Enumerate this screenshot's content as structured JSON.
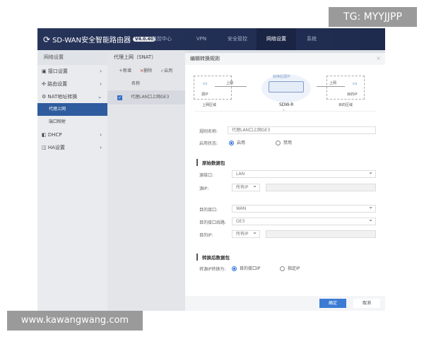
{
  "watermarks": {
    "tg": "TG: MYYJJPP",
    "site": "www.kawangwang.com"
  },
  "header": {
    "title": "SD-WAN安全智能路由器",
    "version": "V4.0.40",
    "nav": [
      "监控中心",
      "VPN",
      "安全管控",
      "网络设置",
      "系统"
    ],
    "active": "网络设置"
  },
  "sidebar": {
    "title": "网络设置",
    "items": [
      {
        "label": "接口设置",
        "icon": "interface-icon"
      },
      {
        "label": "路由设置",
        "icon": "route-icon"
      },
      {
        "label": "NAT地址转换",
        "icon": "nat-icon",
        "expanded": true
      },
      {
        "label": "代理上网",
        "sub": true,
        "selected": true
      },
      {
        "label": "端口映射",
        "sub": true
      },
      {
        "label": "DHCP",
        "icon": "dhcp-icon"
      },
      {
        "label": "HA设置",
        "icon": "ha-icon"
      }
    ]
  },
  "list": {
    "title": "代理上网（SNAT）",
    "add": "新增",
    "delete": "删除",
    "enable": "启用",
    "col_name": "名称",
    "rows": [
      {
        "name": "代理LAN口上网GE3",
        "checked": true
      }
    ]
  },
  "modal": {
    "title": "编辑转换规则",
    "diagram": {
      "src_ip": "源IP",
      "uplink": "上网",
      "src_zone": "上网区域",
      "converted_ip": "转换后源IP",
      "device": "SDW-R",
      "dst_ip": "目的IP",
      "dst_zone": "目的区域"
    },
    "rule_name_label": "规则名称:",
    "rule_name": "代理LAN口上网GE3",
    "status_label": "启用状态:",
    "status_on": "启用",
    "status_off": "禁用",
    "orig_section": "原始数据包",
    "src_if_label": "源接口:",
    "src_if": "LAN",
    "src_ip_label": "源IP:",
    "src_ip": "所有IP",
    "dst_if_label": "目的接口:",
    "dst_if": "WAN",
    "dst_line_label": "目的接口线路:",
    "dst_line": "GE3",
    "dst_ip_label": "目的IP:",
    "dst_ip": "所有IP",
    "trans_section": "转换后数据包",
    "convert_label": "将源IP转换为:",
    "convert_opt1": "目的接口IP",
    "convert_opt2": "指定IP",
    "ok": "确定",
    "cancel": "取消"
  },
  "colors": {
    "header": "#27345a",
    "accent": "#2f5c9e",
    "primary_button": "#3b7bd4"
  }
}
